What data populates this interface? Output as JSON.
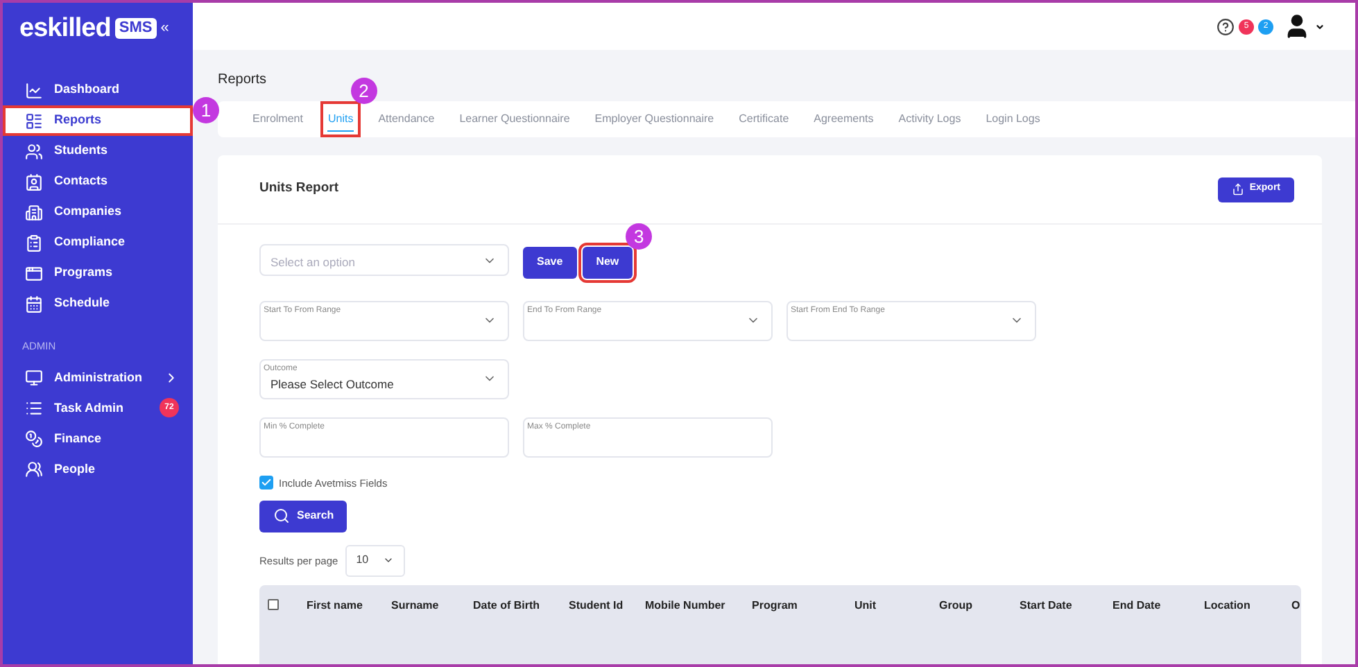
{
  "brand": {
    "name": "eskilled",
    "badge": "SMS",
    "collapse": "«"
  },
  "sidebar": {
    "items": [
      {
        "label": "Dashboard",
        "selected": false
      },
      {
        "label": "Reports",
        "selected": true,
        "highlighted": true,
        "callout": "1"
      },
      {
        "label": "Students",
        "selected": false
      },
      {
        "label": "Contacts",
        "selected": false
      },
      {
        "label": "Companies",
        "selected": false
      },
      {
        "label": "Compliance",
        "selected": false
      },
      {
        "label": "Programs",
        "selected": false
      },
      {
        "label": "Schedule",
        "selected": false
      }
    ],
    "section": "ADMIN",
    "admin_items": [
      {
        "label": "Administration",
        "selected": false,
        "expandable": true
      },
      {
        "label": "Task Admin",
        "selected": false,
        "badge": "72"
      },
      {
        "label": "Finance",
        "selected": false
      },
      {
        "label": "People",
        "selected": false
      }
    ]
  },
  "topbar": {
    "badges": [
      {
        "text": "5",
        "color": "#f0345a"
      },
      {
        "text": "2",
        "color": "#1e9ff2"
      }
    ]
  },
  "page_title": "Reports",
  "tabs": [
    {
      "label": "Enrolment",
      "selected": false
    },
    {
      "label": "Units",
      "selected": true,
      "highlighted": true,
      "callout": "2"
    },
    {
      "label": "Attendance",
      "selected": false
    },
    {
      "label": "Learner Questionnaire",
      "selected": false
    },
    {
      "label": "Employer Questionnaire",
      "selected": false
    },
    {
      "label": "Certificate",
      "selected": false
    },
    {
      "label": "Agreements",
      "selected": false
    },
    {
      "label": "Activity Logs",
      "selected": false
    },
    {
      "label": "Login Logs",
      "selected": false
    }
  ],
  "report": {
    "title": "Units Report",
    "export": "Export",
    "saved_select": {
      "placeholder": "Select an option"
    },
    "buttons": [
      {
        "label": "Save"
      },
      {
        "label": "New",
        "highlighted": true,
        "callout": "3"
      }
    ],
    "ranges": [
      {
        "label": "Start To From Range"
      },
      {
        "label": "End To From Range"
      },
      {
        "label": "Start From End To Range"
      }
    ],
    "outcome": {
      "label": "Outcome",
      "value": "Please Select Outcome"
    },
    "percent_fields": [
      {
        "label": "Min % Complete"
      },
      {
        "label": "Max % Complete"
      }
    ],
    "avetmiss": {
      "label": "Include Avetmiss Fields",
      "checked": true
    },
    "search": "Search",
    "results_per_page": {
      "label": "Results per page",
      "value": "10"
    },
    "table": {
      "select_all": {
        "checked": false
      },
      "columns": [
        "First name",
        "Surname",
        "Date of Birth",
        "Student Id",
        "Mobile Number",
        "Program",
        "Unit",
        "Group",
        "Start Date",
        "End Date",
        "Location",
        "O"
      ]
    }
  }
}
